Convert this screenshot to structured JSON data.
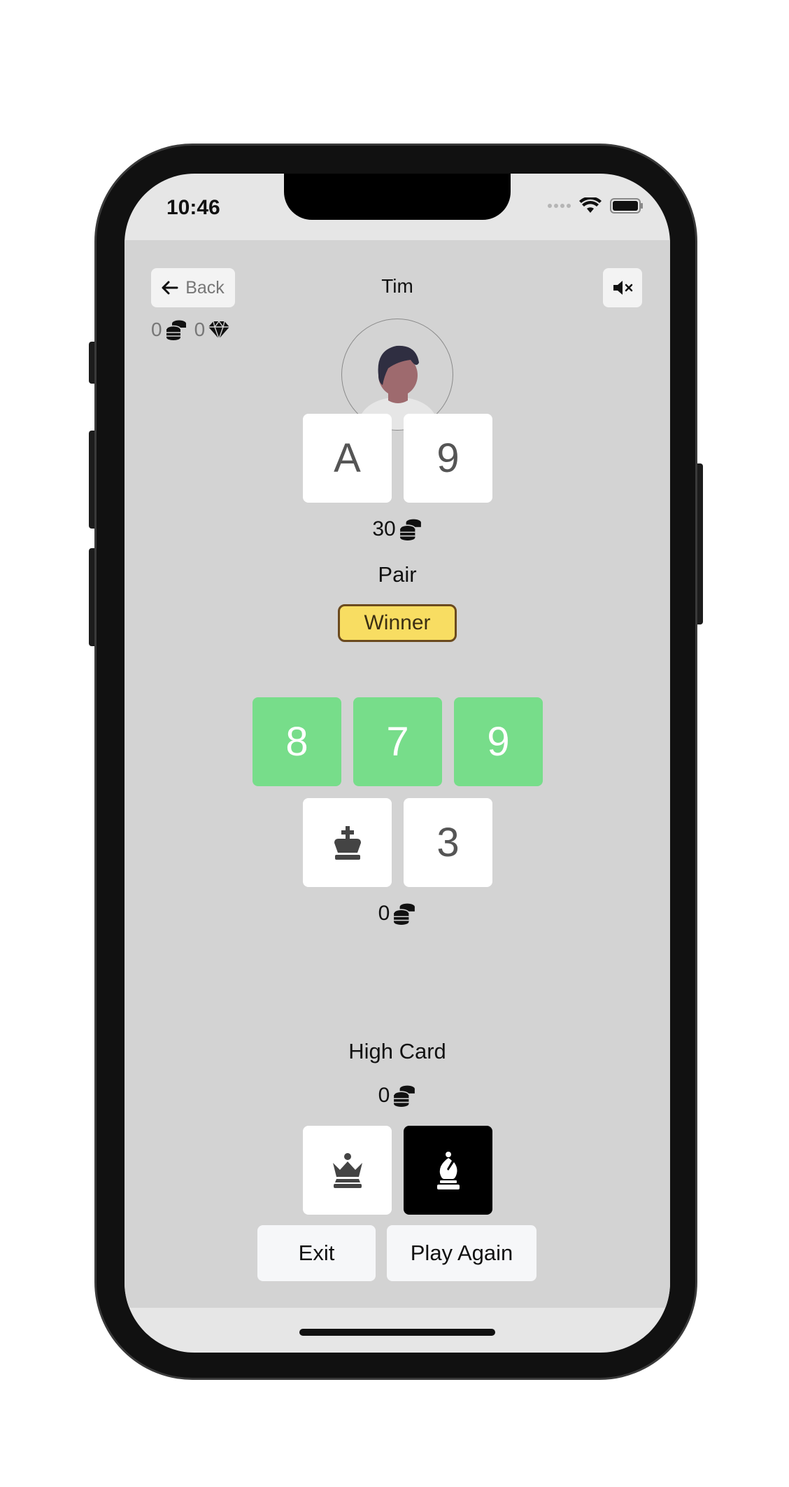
{
  "status_bar": {
    "time": "10:46"
  },
  "header": {
    "back_label": "Back",
    "player_name": "Tim",
    "coins": "0",
    "gems": "0"
  },
  "opponent": {
    "cards": [
      "A",
      "9"
    ],
    "bet": "30",
    "hand": "Pair",
    "badge": "Winner"
  },
  "community": {
    "cards": [
      "8",
      "7",
      "9"
    ],
    "accent_color": "#77dd8a"
  },
  "middle_hand": {
    "cards": [
      "king-icon",
      "3"
    ],
    "bet": "0"
  },
  "player": {
    "hand": "High Card",
    "bet": "0",
    "cards": [
      "queen-icon",
      "bishop-icon"
    ]
  },
  "actions": {
    "exit_label": "Exit",
    "play_again_label": "Play Again"
  }
}
